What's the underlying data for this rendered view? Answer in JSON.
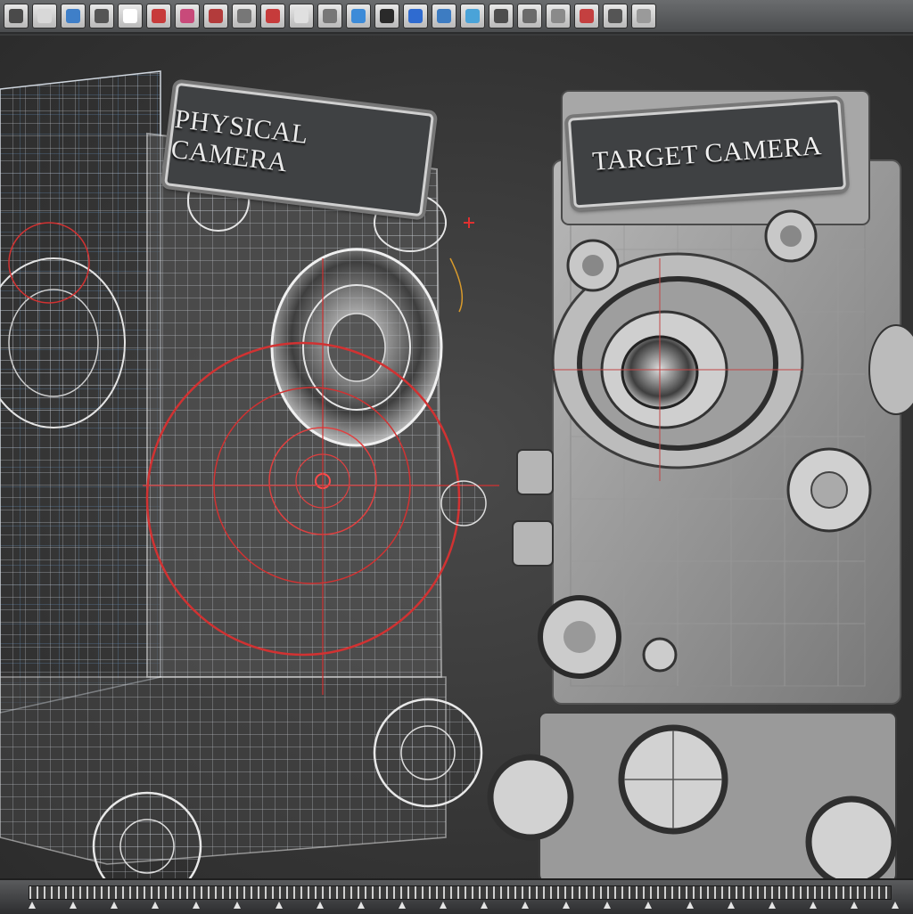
{
  "toolbar": {
    "buttons": [
      {
        "name": "menu-button",
        "icon": "menu-icon",
        "color": "#4a4a4a"
      },
      {
        "name": "file-button",
        "icon": "document-icon",
        "color": "#d8d8d8"
      },
      {
        "name": "import-button",
        "icon": "import-icon",
        "color": "#3f7fc8"
      },
      {
        "name": "select-tool-button",
        "icon": "select-icon",
        "color": "#555555"
      },
      {
        "name": "transform-button",
        "icon": "transform-icon",
        "color": "#ffffff"
      },
      {
        "name": "brush-button",
        "icon": "brush-icon",
        "color": "#c73b3b"
      },
      {
        "name": "paint-button",
        "icon": "paint-icon",
        "color": "#c84a7a"
      },
      {
        "name": "render-tools-button",
        "icon": "render-icon",
        "color": "#b33b3b"
      },
      {
        "name": "viewport-tools-button",
        "icon": "viewport-icon",
        "color": "#777777"
      },
      {
        "name": "material-button",
        "icon": "material-icon",
        "color": "#c63b3b"
      },
      {
        "name": "shape-button",
        "icon": "shape-icon",
        "color": "#e0e0e0"
      },
      {
        "name": "camera-button",
        "icon": "camera-icon",
        "color": "#777777"
      },
      {
        "name": "gallery-button",
        "icon": "gallery-icon",
        "color": "#3d8bd8"
      },
      {
        "name": "layer-button",
        "icon": "layer-icon",
        "color": "#2a2a2a"
      },
      {
        "name": "play-button",
        "icon": "play-icon",
        "color": "#2f6bd0"
      },
      {
        "name": "globe-button",
        "icon": "globe-icon",
        "color": "#3d7cc2"
      },
      {
        "name": "image-button",
        "icon": "image-icon",
        "color": "#4aa3d8"
      },
      {
        "name": "scene-button",
        "icon": "scene-icon",
        "color": "#4d4d4d"
      },
      {
        "name": "palette-button",
        "icon": "palette-icon",
        "color": "#6a6a6a"
      },
      {
        "name": "snap-button",
        "icon": "snap-icon",
        "color": "#8a8a8a"
      },
      {
        "name": "light-button",
        "icon": "light-icon",
        "color": "#c44040"
      },
      {
        "name": "settings-button",
        "icon": "settings-icon",
        "color": "#555555"
      },
      {
        "name": "more-button",
        "icon": "more-icon",
        "color": "#9a9a9a"
      }
    ]
  },
  "scene": {
    "physical_label": "PHYSICAL CAMERA",
    "target_label": "TARGET CAMERA"
  },
  "timeline": {
    "keyframes": 22
  }
}
